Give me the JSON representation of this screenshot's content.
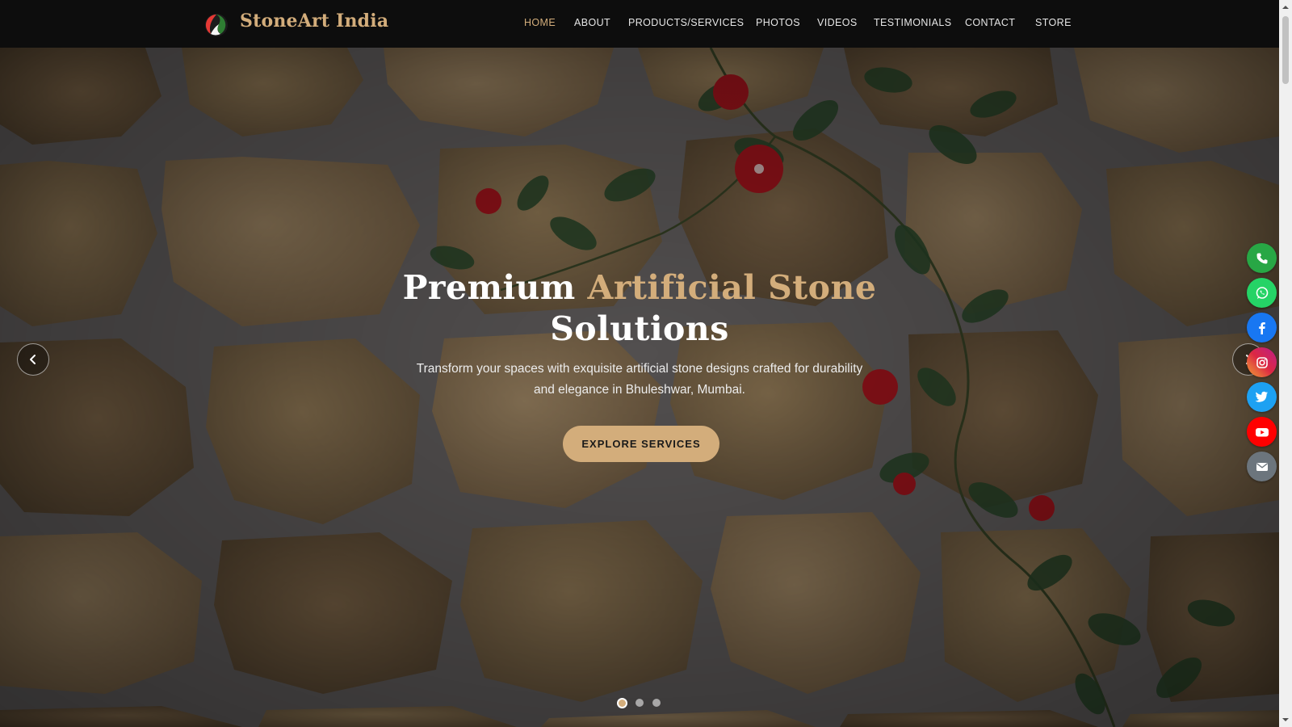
{
  "brand": {
    "name": "StoneArt India",
    "logo_icon": "stoneart-logo-icon"
  },
  "nav": {
    "items": [
      {
        "label": "HOME",
        "active": true
      },
      {
        "label": "ABOUT"
      },
      {
        "label": "PRODUCTS/SERVICES"
      },
      {
        "label": "PHOTOS"
      },
      {
        "label": "VIDEOS"
      },
      {
        "label": "TESTIMONIALS"
      },
      {
        "label": "CONTACT"
      },
      {
        "label": "STORE"
      }
    ]
  },
  "hero": {
    "title_part1": "Premium",
    "title_accent": "Artificial Stone",
    "title_part2": "Solutions",
    "subtitle": "Transform your spaces with exquisite artificial stone designs crafted for durability and elegance in Bhuleshwar, Mumbai.",
    "cta_label": "EXPLORE SERVICES",
    "slides_count": 3,
    "active_slide": 1
  },
  "social": [
    {
      "name": "phone-icon",
      "color": "#28a745"
    },
    {
      "name": "whatsapp-icon",
      "color": "#25d366"
    },
    {
      "name": "facebook-icon",
      "color": "#1877f2"
    },
    {
      "name": "instagram-icon",
      "color": "#e1306c"
    },
    {
      "name": "twitter-icon",
      "color": "#1da1f2"
    },
    {
      "name": "youtube-icon",
      "color": "#ff0000"
    },
    {
      "name": "email-icon",
      "color": "#6c757d"
    }
  ],
  "colors": {
    "accent": "#d3ad7b",
    "header_bg": "#0d0d0d"
  }
}
